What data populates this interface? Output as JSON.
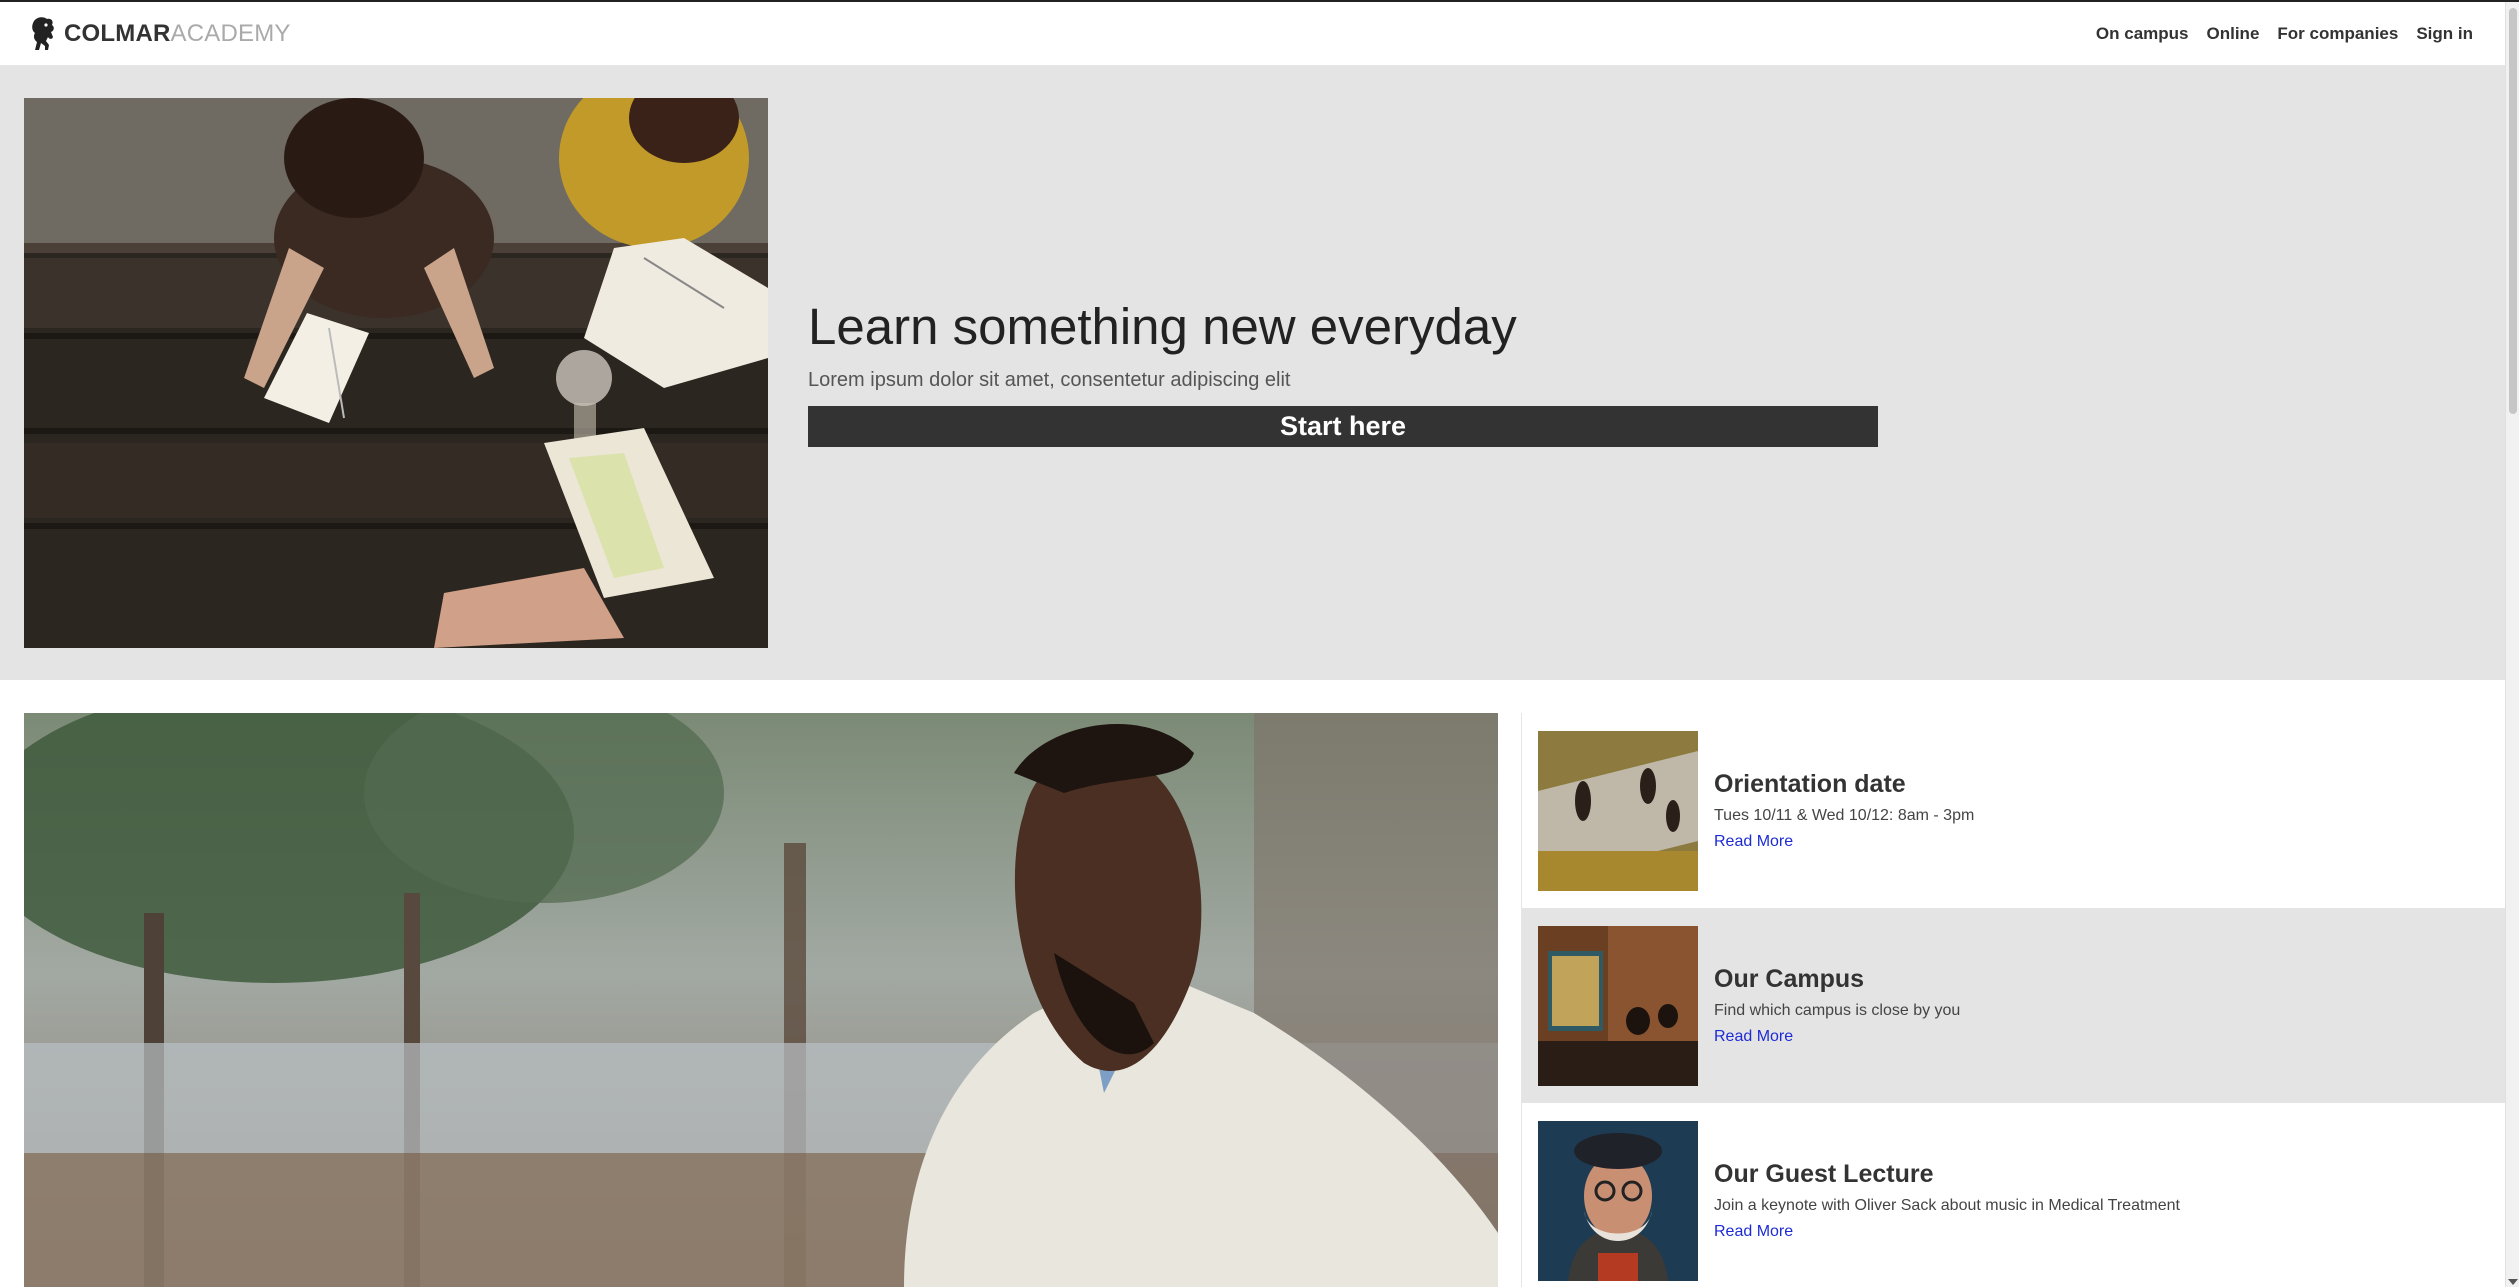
{
  "header": {
    "logo_strong": "COLMAR",
    "logo_light": "ACADEMY",
    "nav": [
      {
        "label": "On campus"
      },
      {
        "label": "Online"
      },
      {
        "label": "For companies"
      },
      {
        "label": "Sign in"
      }
    ]
  },
  "hero": {
    "title": "Learn something new everyday",
    "subtitle": "Lorem ipsum dolor sit amet, consentetur adipiscing elit",
    "button_label": "Start here"
  },
  "side_items": [
    {
      "title": "Orientation date",
      "desc": "Tues 10/11 & Wed 10/12: 8am - 3pm",
      "link": "Read More"
    },
    {
      "title": "Our Campus",
      "desc": "Find which campus is close by you",
      "link": "Read More"
    },
    {
      "title": "Our Guest Lecture",
      "desc": "Join a keynote with Oliver Sack about music in Medical Treatment",
      "link": "Read More"
    }
  ],
  "colors": {
    "hero_bg": "#e4e4e4",
    "button_bg": "#333333",
    "link": "#1d2bd6"
  }
}
